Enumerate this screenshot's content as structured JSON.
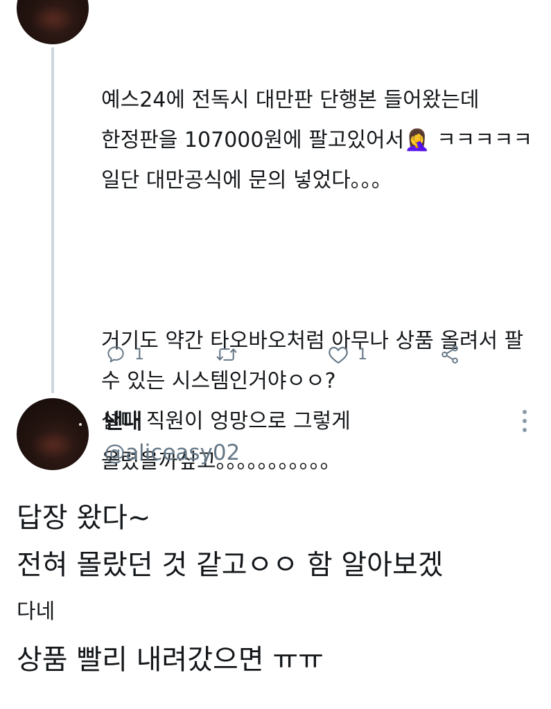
{
  "previous_tweet": {
    "paragraph1": "예스24에 전독시 대만판 단행본 들어왔는데 한정판을 107000원에 팔고있어서🤦‍♀️ ㅋㅋㅋㅋㅋ 일단 대만공식에 문의 넣었다。。。",
    "paragraph2": "거기도 약간 타오바오처럼 아무나 상품 올려서 팔 수 있는 시스템인거야ㅇㅇ?\n설마 직원이 엉망으로 그렇게 올렸을까싶고。。。。。。。。。。。",
    "actions": {
      "reply_count": "1",
      "retweet_count": "",
      "like_count": "1"
    },
    "icons": {
      "reply": "reply-icon",
      "retweet": "retweet-icon",
      "like": "heart-icon",
      "share": "share-icon"
    }
  },
  "reply_tweet": {
    "author_name": "낸내",
    "author_handle": "@aliceasy02",
    "line1": "답장 왔다~",
    "line2": "전혀 몰랐던 것 같고ㅇㅇ 함 알아보겠",
    "line3": "다네",
    "line4": "상품 빨리 내려갔으면 ㅠㅠ",
    "more_icon": "more-vertical-icon"
  },
  "colors": {
    "text": "#14171a",
    "secondary": "#657786",
    "thread_line": "#ccd6dd"
  }
}
